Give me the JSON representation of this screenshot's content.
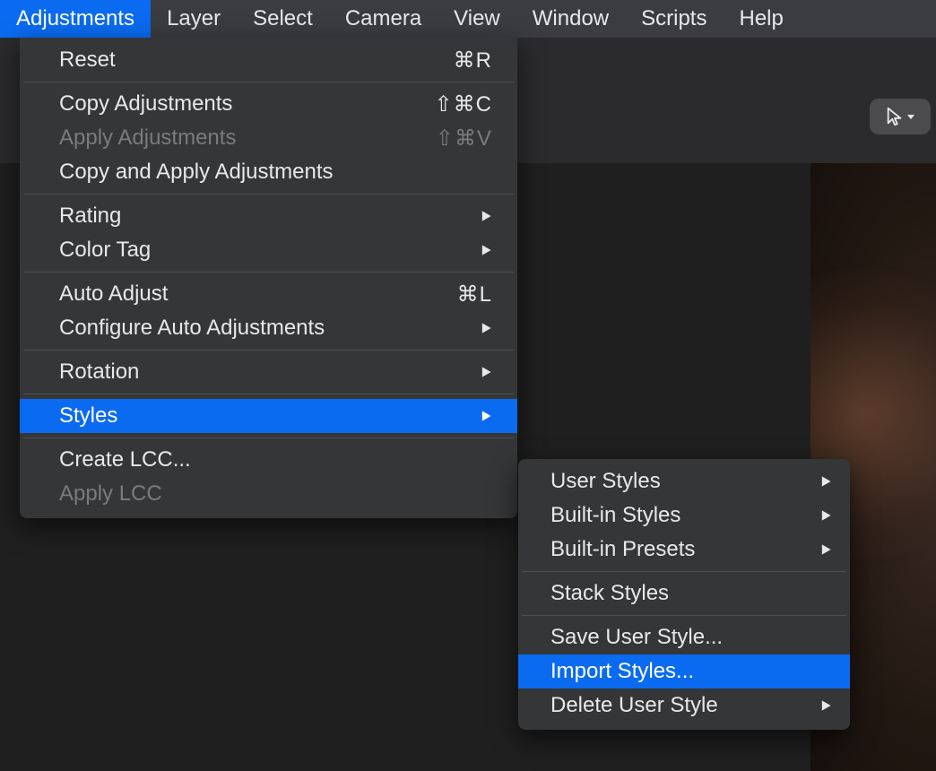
{
  "menubar": {
    "items": [
      {
        "label": "Adjustments",
        "active": true
      },
      {
        "label": "Layer",
        "active": false
      },
      {
        "label": "Select",
        "active": false
      },
      {
        "label": "Camera",
        "active": false
      },
      {
        "label": "View",
        "active": false
      },
      {
        "label": "Window",
        "active": false
      },
      {
        "label": "Scripts",
        "active": false
      },
      {
        "label": "Help",
        "active": false
      }
    ]
  },
  "dropdown": {
    "groups": [
      [
        {
          "label": "Reset",
          "shortcut": "⌘R"
        }
      ],
      [
        {
          "label": "Copy Adjustments",
          "shortcut": "⇧⌘C"
        },
        {
          "label": "Apply Adjustments",
          "shortcut": "⇧⌘V",
          "disabled": true
        },
        {
          "label": "Copy and Apply Adjustments"
        }
      ],
      [
        {
          "label": "Rating",
          "submenu": true
        },
        {
          "label": "Color Tag",
          "submenu": true
        }
      ],
      [
        {
          "label": "Auto Adjust",
          "shortcut": "⌘L"
        },
        {
          "label": "Configure Auto Adjustments",
          "submenu": true
        }
      ],
      [
        {
          "label": "Rotation",
          "submenu": true
        }
      ],
      [
        {
          "label": "Styles",
          "submenu": true,
          "highlight": true
        }
      ],
      [
        {
          "label": "Create LCC..."
        },
        {
          "label": "Apply LCC",
          "disabled": true
        }
      ]
    ]
  },
  "submenu": {
    "groups": [
      [
        {
          "label": "User Styles",
          "submenu": true
        },
        {
          "label": "Built-in Styles",
          "submenu": true
        },
        {
          "label": "Built-in Presets",
          "submenu": true
        }
      ],
      [
        {
          "label": "Stack Styles"
        }
      ],
      [
        {
          "label": "Save User Style..."
        },
        {
          "label": "Import Styles...",
          "highlight": true
        },
        {
          "label": "Delete User Style",
          "submenu": true
        }
      ]
    ]
  }
}
